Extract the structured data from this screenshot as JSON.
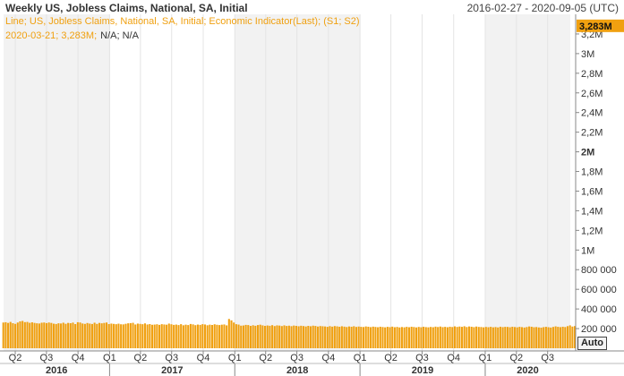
{
  "header": {
    "title": "Weekly US, Jobless Claims, National, SA, Initial",
    "date_range": "2016-02-27 - 2020-09-05 (UTC)"
  },
  "legend": {
    "series_label": "Line; US, Jobless Claims, National, SA, Initial; Economic Indicator(Last); (S1; S2)",
    "readout_date_value": "2020-03-21; 3,283M;",
    "readout_na": "N/A; N/A"
  },
  "auto_button": "Auto",
  "colors": {
    "series": "#f0a010",
    "last_badge": "#f0a010",
    "shade": "#f2f2f2"
  },
  "chart_data": {
    "type": "bar",
    "title": "Weekly US, Jobless Claims, National, SA, Initial",
    "x_range": [
      "2016-02-27",
      "2020-09-05"
    ],
    "ylim": [
      0,
      3400000
    ],
    "y_ticks": [
      {
        "v": 200000,
        "label": "200 000"
      },
      {
        "v": 400000,
        "label": "400 000"
      },
      {
        "v": 600000,
        "label": "600 000"
      },
      {
        "v": 800000,
        "label": "800 000"
      },
      {
        "v": 1000000,
        "label": "1M"
      },
      {
        "v": 1200000,
        "label": "1,2M"
      },
      {
        "v": 1400000,
        "label": "1,4M"
      },
      {
        "v": 1600000,
        "label": "1,6M"
      },
      {
        "v": 1800000,
        "label": "1,8M"
      },
      {
        "v": 2000000,
        "label": "2M",
        "bold": true
      },
      {
        "v": 2200000,
        "label": "2,2M"
      },
      {
        "v": 2400000,
        "label": "2,4M"
      },
      {
        "v": 2600000,
        "label": "2,6M"
      },
      {
        "v": 2800000,
        "label": "2,8M"
      },
      {
        "v": 3000000,
        "label": "3M"
      },
      {
        "v": 3200000,
        "label": "3,2M"
      }
    ],
    "last_value_label": "3,283M",
    "quarter_ticks": [
      {
        "date": "2016-04-01",
        "label": "Q2"
      },
      {
        "date": "2016-07-01",
        "label": "Q3"
      },
      {
        "date": "2016-10-01",
        "label": "Q4"
      },
      {
        "date": "2017-01-01",
        "label": "Q1"
      },
      {
        "date": "2017-04-01",
        "label": "Q2"
      },
      {
        "date": "2017-07-01",
        "label": "Q3"
      },
      {
        "date": "2017-10-01",
        "label": "Q4"
      },
      {
        "date": "2018-01-01",
        "label": "Q1"
      },
      {
        "date": "2018-04-01",
        "label": "Q2"
      },
      {
        "date": "2018-07-01",
        "label": "Q3"
      },
      {
        "date": "2018-10-01",
        "label": "Q4"
      },
      {
        "date": "2019-01-01",
        "label": "Q1"
      },
      {
        "date": "2019-04-01",
        "label": "Q2"
      },
      {
        "date": "2019-07-01",
        "label": "Q3"
      },
      {
        "date": "2019-10-01",
        "label": "Q4"
      },
      {
        "date": "2020-01-01",
        "label": "Q1"
      },
      {
        "date": "2020-04-01",
        "label": "Q2"
      },
      {
        "date": "2020-07-01",
        "label": "Q3"
      }
    ],
    "years": [
      {
        "start": "2016-02-27",
        "end": "2017-01-01",
        "label": "2016"
      },
      {
        "start": "2017-01-01",
        "end": "2018-01-01",
        "label": "2017"
      },
      {
        "start": "2018-01-01",
        "end": "2019-01-01",
        "label": "2018"
      },
      {
        "start": "2019-01-01",
        "end": "2020-01-01",
        "label": "2019"
      },
      {
        "start": "2020-01-01",
        "end": "2020-09-05",
        "label": "2020"
      }
    ],
    "series": [
      {
        "start_date": "2016-02-27",
        "interval_days": 7,
        "values": [
          262000,
          265000,
          258000,
          268000,
          255000,
          248000,
          262000,
          274000,
          278000,
          266000,
          268000,
          259000,
          264000,
          258000,
          254000,
          252000,
          260000,
          262000,
          256000,
          262000,
          258000,
          250000,
          247000,
          254000,
          252000,
          260000,
          249000,
          258000,
          255000,
          261000,
          246000,
          265000,
          262000,
          252000,
          248000,
          257000,
          251000,
          247000,
          260000,
          248000,
          258000,
          254000,
          258000,
          262000,
          246000,
          251000,
          248000,
          245000,
          250000,
          244000,
          243000,
          249000,
          254000,
          256000,
          259000,
          242000,
          251000,
          248000,
          245000,
          253000,
          242000,
          246000,
          239000,
          241000,
          244000,
          238000,
          245000,
          242000,
          240000,
          251000,
          244000,
          238000,
          241000,
          236000,
          245000,
          234000,
          240000,
          236000,
          247000,
          243000,
          235000,
          241000,
          238000,
          245000,
          242000,
          234000,
          240000,
          237000,
          244000,
          239000,
          236000,
          240000,
          242000,
          233000,
          298000,
          284000,
          262000,
          245000,
          241000,
          230000,
          232000,
          238000,
          236000,
          228000,
          234000,
          229000,
          236000,
          240000,
          233000,
          228000,
          232000,
          229000,
          235000,
          226000,
          233000,
          231000,
          226000,
          233000,
          227000,
          230000,
          225000,
          231000,
          228000,
          224000,
          229000,
          226000,
          222000,
          228000,
          224000,
          230000,
          227000,
          221000,
          226000,
          224000,
          222000,
          218000,
          225000,
          220000,
          226000,
          223000,
          219000,
          224000,
          220000,
          216000,
          222000,
          219000,
          224000,
          217000,
          221000,
          218000,
          216000,
          222000,
          219000,
          215000,
          220000,
          217000,
          214000,
          219000,
          216000,
          213000,
          218000,
          215000,
          220000,
          214000,
          217000,
          212000,
          216000,
          213000,
          218000,
          214000,
          219000,
          216000,
          212000,
          217000,
          214000,
          219000,
          215000,
          213000,
          217000,
          214000,
          220000,
          216000,
          221000,
          215000,
          218000,
          214000,
          219000,
          216000,
          223000,
          217000,
          221000,
          218000,
          224000,
          216000,
          222000,
          219000,
          215000,
          221000,
          217000,
          216000,
          213000,
          217000,
          214000,
          218000,
          213000,
          216000,
          212000,
          219000,
          215000,
          218000,
          217000,
          214000,
          219000,
          216000,
          213000,
          218000,
          215000,
          211000,
          216000,
          222000,
          219000,
          214000,
          216000,
          212000,
          210000,
          215000,
          218000,
          214000,
          211000,
          217000,
          223000,
          218000,
          215000,
          219000,
          216000,
          225000,
          233000,
          221000,
          226000,
          211000,
          215000,
          216000,
          220000,
          214000,
          211000,
          3283000
        ]
      }
    ]
  }
}
